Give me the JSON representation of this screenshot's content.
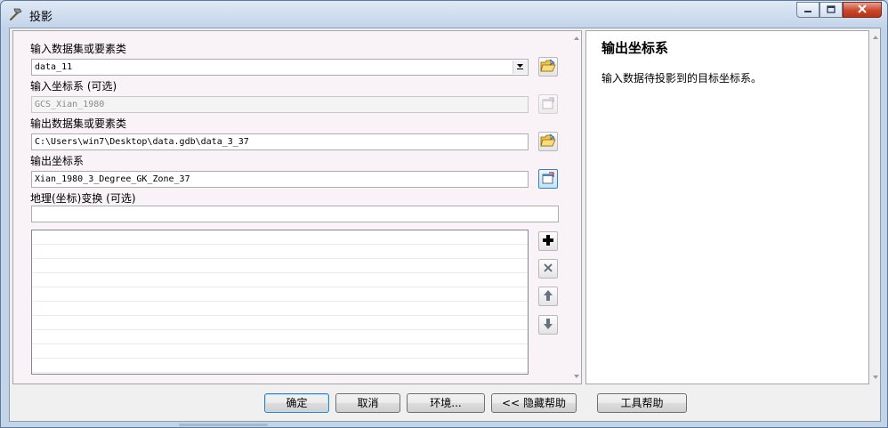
{
  "window": {
    "title": "投影",
    "title_icon": "hammer-icon",
    "controls": [
      "minimize-icon",
      "maximize-icon",
      "close-icon"
    ]
  },
  "form": {
    "input_dataset": {
      "label": "输入数据集或要素类",
      "value": "data_11"
    },
    "input_crs": {
      "label": "输入坐标系 (可选)",
      "value": "GCS_Xian_1980"
    },
    "output_dataset": {
      "label": "输出数据集或要素类",
      "value": "C:\\Users\\win7\\Desktop\\data.gdb\\data_3_37"
    },
    "output_crs": {
      "label": "输出坐标系",
      "value": "Xian_1980_3_Degree_GK_Zone_37"
    },
    "geo_transform": {
      "label": "地理(坐标)变换 (可选)",
      "value": ""
    },
    "list_tools": [
      "add-icon",
      "remove-icon",
      "move-up-icon",
      "move-down-icon"
    ]
  },
  "buttons": {
    "ok": "确定",
    "cancel": "取消",
    "env": "环境...",
    "hide_help": "<< 隐藏帮助",
    "tool_help": "工具帮助"
  },
  "help": {
    "title": "输出坐标系",
    "text": "输入数据待投影到的目标坐标系。"
  },
  "colors": {
    "window_frame": "#c3d4e9",
    "form_bg": "#f9f3f7",
    "close_button": "#c9462c",
    "focus_accent": "#3c7fb1"
  }
}
